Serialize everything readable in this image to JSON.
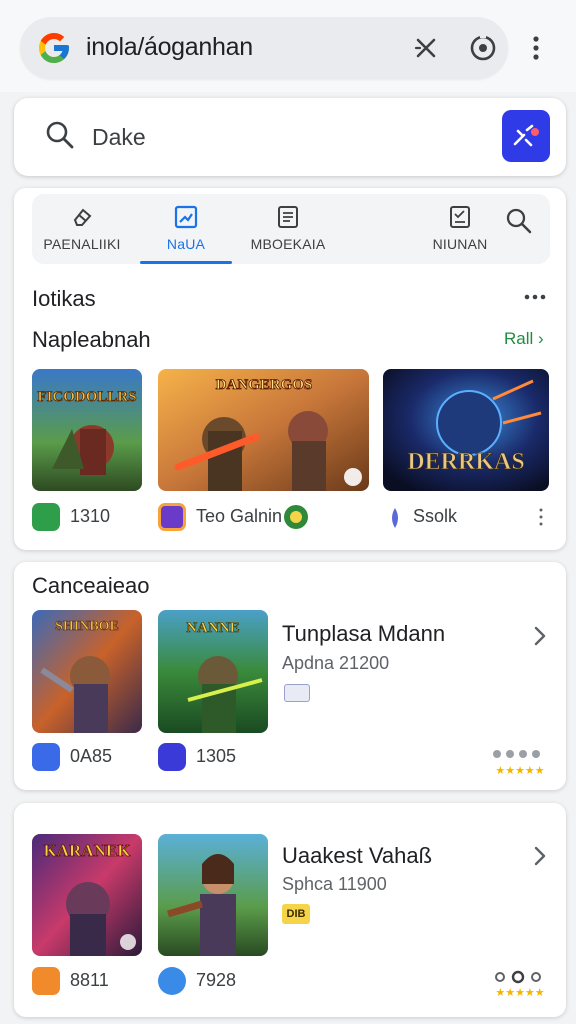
{
  "browser": {
    "url": "inola/áoganhan"
  },
  "search": {
    "query": "Dake"
  },
  "tabs": [
    {
      "label": "PAENALIIKI"
    },
    {
      "label": "NaUA"
    },
    {
      "label": "MBOEKAIA"
    },
    {
      "label": "NIUNAN"
    }
  ],
  "panel1": {
    "heading": "Iotikas",
    "section_title": "Napleabnah",
    "see_all": "Rall",
    "cards": [
      {
        "thumb_text": "FICODOLLRS",
        "meta": "1310"
      },
      {
        "thumb_text": "DANGERGOS",
        "meta": "Teo Galnin"
      },
      {
        "thumb_text": "DERRKAS",
        "meta": "Ssolk"
      }
    ]
  },
  "panel2": {
    "heading": "Canceaieao",
    "thumbs": [
      {
        "thumb_text": "SHINBOE"
      },
      {
        "thumb_text": "NANNE"
      }
    ],
    "metas": [
      "0A85",
      "1305"
    ],
    "title": "Tunplasa Mdann",
    "subtitle": "Apdna 21200"
  },
  "panel3": {
    "thumbs": [
      {
        "thumb_text": "KARANEK"
      },
      {
        "thumb_text": ""
      }
    ],
    "metas": [
      "8811",
      "7928"
    ],
    "title": "Uaakest Vahaß",
    "subtitle": "Sphca 11900",
    "badge": "DIB"
  },
  "colors": {
    "accent_blue": "#1a73e8",
    "ai_button": "#2f3be6",
    "see_all_green": "#1e8e3e",
    "rating_gold": "#f2b600"
  }
}
